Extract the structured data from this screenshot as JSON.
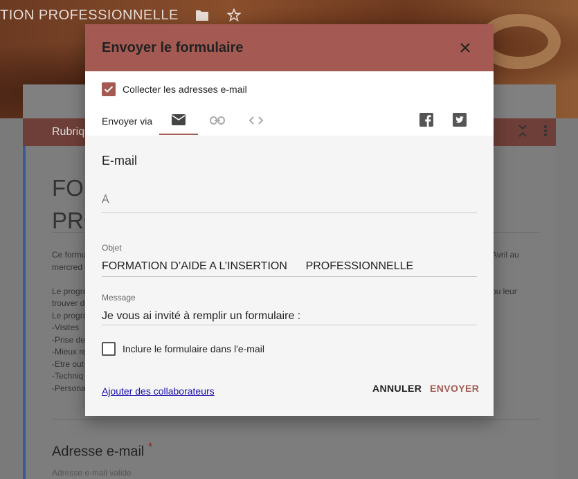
{
  "background": {
    "topbar_title": "TION PROFESSIONNELLE",
    "folder_icon": "folder-icon",
    "star_icon": "star-icon",
    "section_label": "Rubriqu",
    "form_title_lines": [
      "FO",
      "PRO"
    ],
    "description_left": [
      "Ce formu",
      "mercred",
      "",
      "Le progra",
      "trouver d",
      "Le progra",
      "-Visites",
      "-Prise de",
      "-Mieux re",
      "-Etre out",
      "-Techniq",
      "-Persona"
    ],
    "description_right": [
      "Avril au",
      "",
      "",
      "ou leur"
    ],
    "email_question": "Adresse e-mail",
    "required_mark": "*",
    "email_hint": "Adresse e-mail valide"
  },
  "dialog": {
    "title": "Envoyer le formulaire",
    "collect_label": "Collecter les adresses e-mail",
    "collect_checked": true,
    "send_via_label": "Envoyer via",
    "tabs": [
      {
        "icon": "envelope-icon",
        "active": true
      },
      {
        "icon": "link-icon",
        "active": false
      },
      {
        "icon": "embed-code-icon",
        "active": false
      }
    ],
    "social": [
      "facebook-icon",
      "twitter-icon"
    ],
    "email_heading": "E-mail",
    "to_placeholder": "À",
    "subject_label": "Objet",
    "subject_value": "FORMATION D’AIDE A L’INSERTION      PROFESSIONNELLE",
    "message_label": "Message",
    "message_value": "Je vous ai invité à remplir un formulaire :",
    "include_label": "Inclure le formulaire dans l'e-mail",
    "include_checked": false,
    "collaborators_link": "Ajouter des collaborateurs",
    "cancel_label": "ANNULER",
    "send_label": "ENVOYER",
    "accent_color": "#a45a52"
  }
}
